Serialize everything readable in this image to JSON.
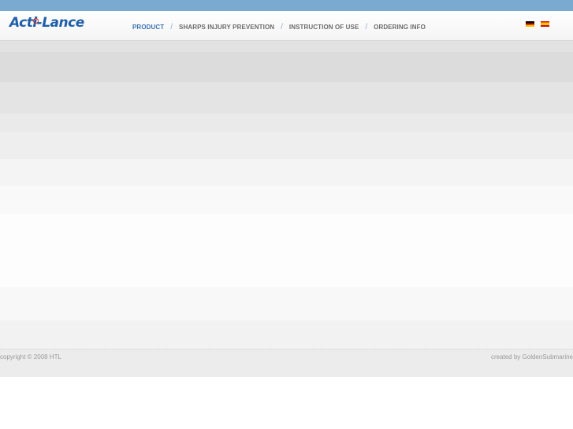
{
  "header": {
    "logo_text": "Acti-Lance",
    "nav": [
      {
        "label": "PRODUCT",
        "active": true
      },
      {
        "label": "SHARPS INJURY PREVENTION",
        "active": false
      },
      {
        "label": "INSTRUCTION OF USE",
        "active": false
      },
      {
        "label": "ORDERING INFO",
        "active": false
      }
    ],
    "separator": "/",
    "languages": [
      {
        "icon": "flag-germany-icon"
      },
      {
        "icon": "flag-spain-icon"
      }
    ]
  },
  "footer": {
    "copyright": "copyright © 2008 HTL",
    "credit": "created by GoldenSubmarine"
  },
  "colors": {
    "topbar": "#7aaad0",
    "logo": "#1f5fa8",
    "nav_active": "#3b72b4",
    "nav_inactive": "#6a6a6a"
  }
}
